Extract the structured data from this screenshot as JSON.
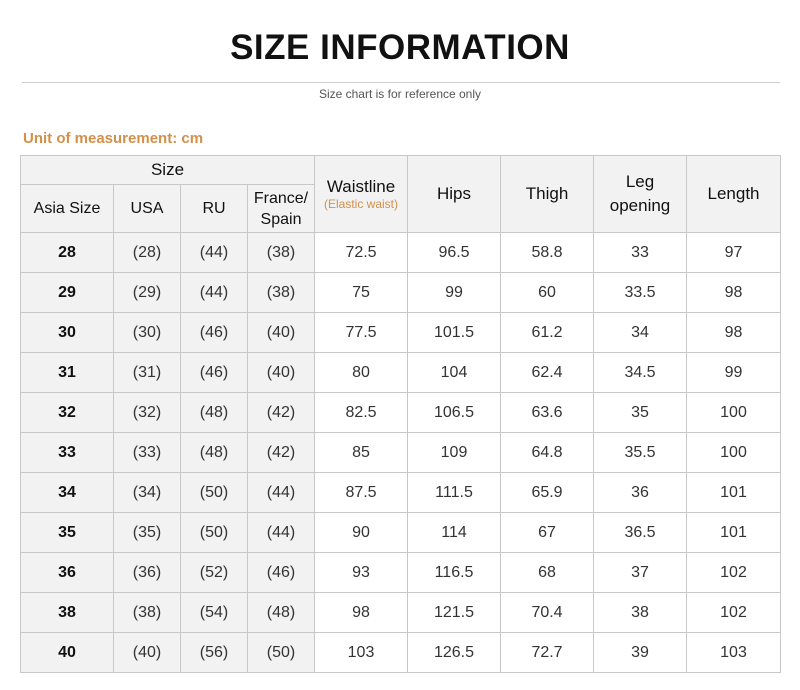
{
  "header": {
    "title": "SIZE INFORMATION",
    "subtitle": "Size chart is for reference only",
    "unit_label": "Unit of measurement: cm"
  },
  "colors": {
    "accent": "#d2904a",
    "header_bg": "#f2f2f2",
    "border": "#c8c8c8"
  },
  "table": {
    "size_group": "Size",
    "columns": {
      "asia": "Asia Size",
      "usa": "USA",
      "ru": "RU",
      "france_line1": "France/",
      "france_line2": "Spain",
      "waistline": "Waistline",
      "waistline_note": "(Elastic waist)",
      "hips": "Hips",
      "thigh": "Thigh",
      "leg_line1": "Leg",
      "leg_line2": "opening",
      "length": "Length"
    },
    "rows": [
      [
        "28",
        "(28)",
        "(44)",
        "(38)",
        "72.5",
        "96.5",
        "58.8",
        "33",
        "97"
      ],
      [
        "29",
        "(29)",
        "(44)",
        "(38)",
        "75",
        "99",
        "60",
        "33.5",
        "98"
      ],
      [
        "30",
        "(30)",
        "(46)",
        "(40)",
        "77.5",
        "101.5",
        "61.2",
        "34",
        "98"
      ],
      [
        "31",
        "(31)",
        "(46)",
        "(40)",
        "80",
        "104",
        "62.4",
        "34.5",
        "99"
      ],
      [
        "32",
        "(32)",
        "(48)",
        "(42)",
        "82.5",
        "106.5",
        "63.6",
        "35",
        "100"
      ],
      [
        "33",
        "(33)",
        "(48)",
        "(42)",
        "85",
        "109",
        "64.8",
        "35.5",
        "100"
      ],
      [
        "34",
        "(34)",
        "(50)",
        "(44)",
        "87.5",
        "111.5",
        "65.9",
        "36",
        "101"
      ],
      [
        "35",
        "(35)",
        "(50)",
        "(44)",
        "90",
        "114",
        "67",
        "36.5",
        "101"
      ],
      [
        "36",
        "(36)",
        "(52)",
        "(46)",
        "93",
        "116.5",
        "68",
        "37",
        "102"
      ],
      [
        "38",
        "(38)",
        "(54)",
        "(48)",
        "98",
        "121.5",
        "70.4",
        "38",
        "102"
      ],
      [
        "40",
        "(40)",
        "(56)",
        "(50)",
        "103",
        "126.5",
        "72.7",
        "39",
        "103"
      ]
    ]
  }
}
